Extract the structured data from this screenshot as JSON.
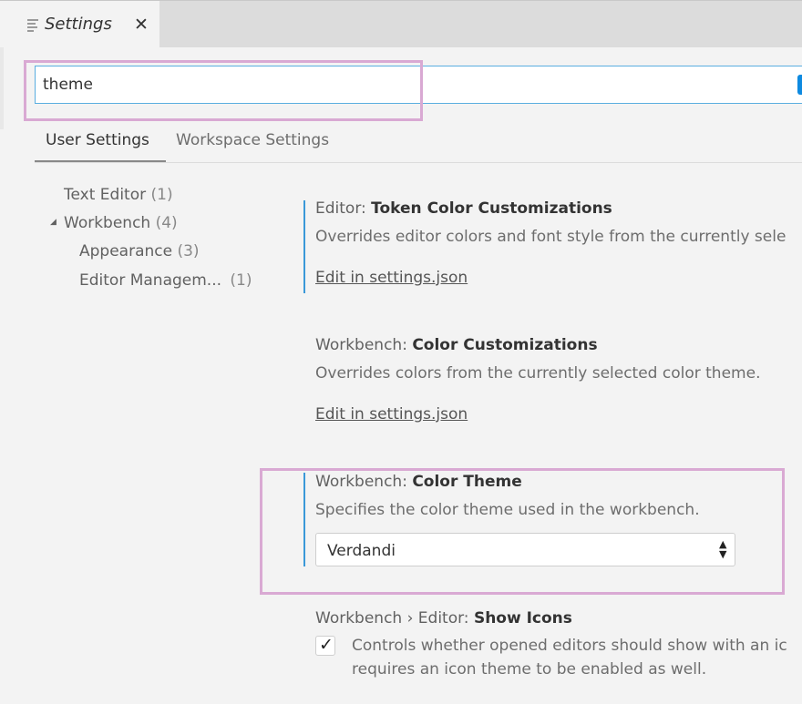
{
  "tab": {
    "title": "Settings",
    "close_icon": "close-icon",
    "file_icon": "settings-file-icon"
  },
  "search": {
    "value": "theme"
  },
  "settings_tabs": {
    "user": "User Settings",
    "workspace": "Workspace Settings"
  },
  "toc": [
    {
      "label": "Text Editor",
      "count": "(1)"
    },
    {
      "label": "Workbench",
      "count": "(4)",
      "expanded": true
    },
    {
      "label": "Appearance",
      "count": "(3)"
    },
    {
      "label": "Editor Managem...",
      "count": "(1)"
    }
  ],
  "settings": [
    {
      "category": "Editor: ",
      "name": "Token Color Customizations",
      "description": "Overrides editor colors and font style from the currently sele",
      "link": "Edit in settings.json"
    },
    {
      "category": "Workbench: ",
      "name": "Color Customizations",
      "description": "Overrides colors from the currently selected color theme.",
      "link": "Edit in settings.json"
    },
    {
      "category": "Workbench: ",
      "name": "Color Theme",
      "description": "Specifies the color theme used in the workbench.",
      "value": "Verdandi"
    },
    {
      "category": "Workbench › Editor: ",
      "name": "Show Icons",
      "checked": true,
      "description_line1": "Controls whether opened editors should show with an ic",
      "description_line2": "requires an icon theme to be enabled as well."
    }
  ],
  "colors": {
    "accent": "#3a98d8",
    "highlight": "#d9a9d3",
    "button": "#0e8ae0"
  }
}
